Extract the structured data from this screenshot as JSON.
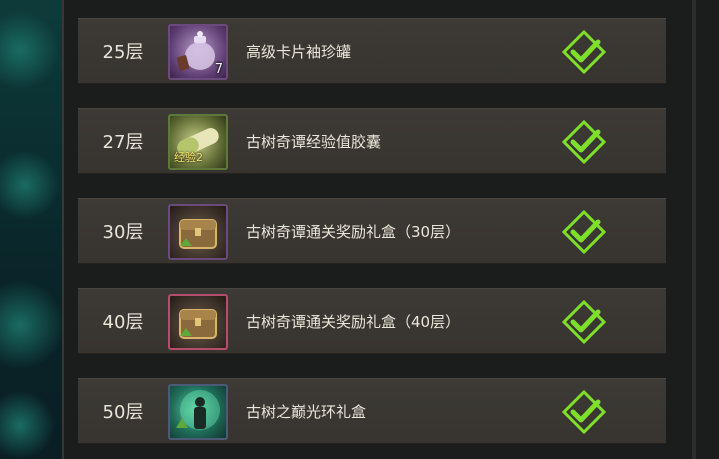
{
  "rewards": [
    {
      "floor": "25层",
      "name": "高级卡片袖珍罐",
      "icon": "jar-icon",
      "count": "7",
      "tag": "",
      "claimed": true
    },
    {
      "floor": "27层",
      "name": "古树奇谭经验值胶囊",
      "icon": "capsule-icon",
      "count": "",
      "tag": "经验2",
      "claimed": true
    },
    {
      "floor": "30层",
      "name": "古树奇谭通关奖励礼盒（30层）",
      "icon": "chest-icon",
      "count": "",
      "tag": "",
      "claimed": true
    },
    {
      "floor": "40层",
      "name": "古树奇谭通关奖励礼盒（40层）",
      "icon": "chest-icon",
      "count": "",
      "tag": "",
      "claimed": true
    },
    {
      "floor": "50层",
      "name": "古树之巅光环礼盒",
      "icon": "aura-box-icon",
      "count": "",
      "tag": "",
      "claimed": true
    }
  ],
  "colors": {
    "check": "#7ee02a",
    "row_bg": "#3b3833",
    "text": "#ebe6da"
  }
}
